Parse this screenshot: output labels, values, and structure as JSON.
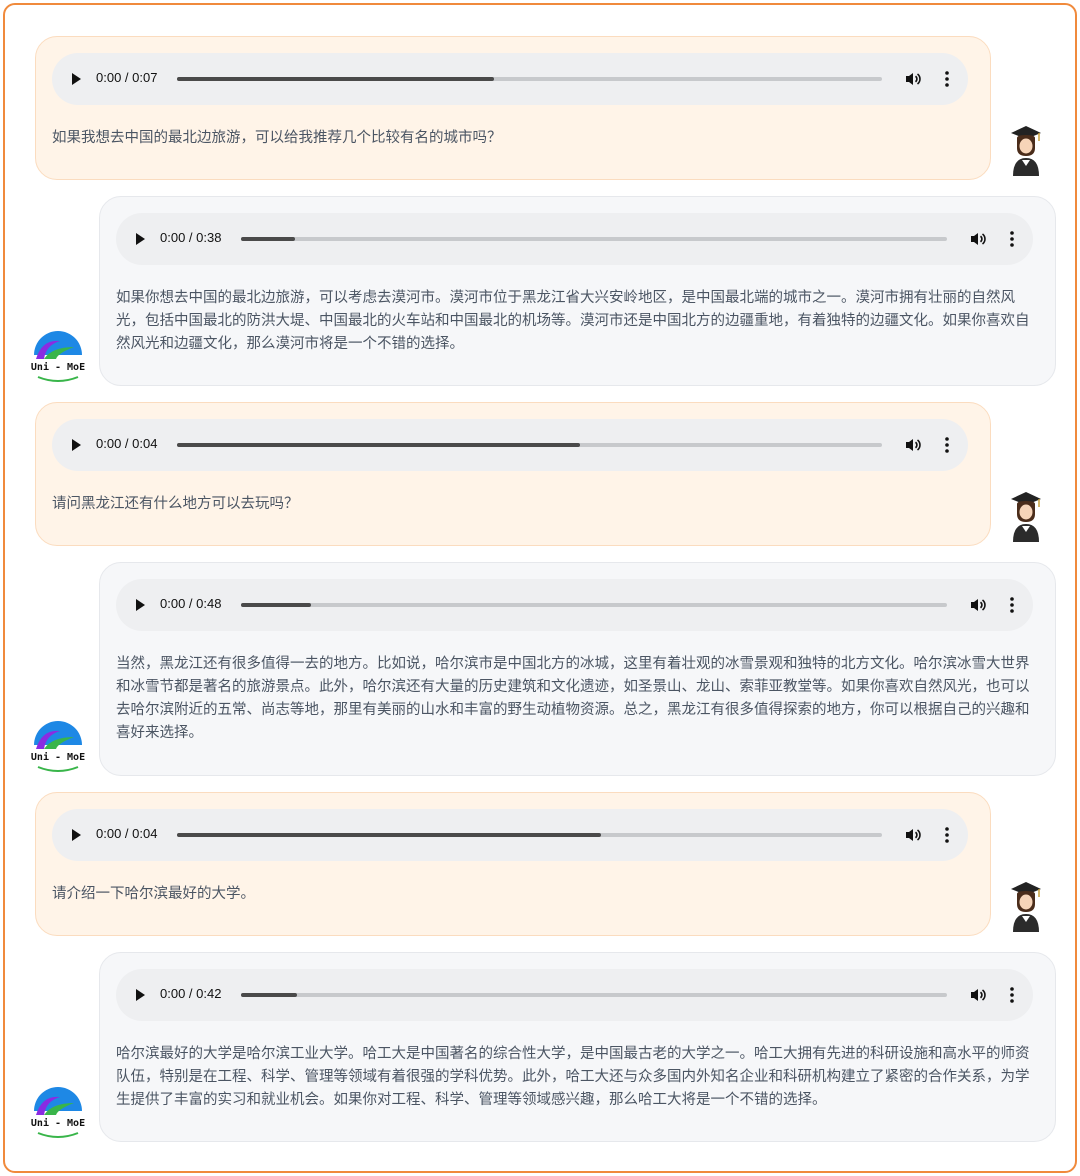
{
  "messages": [
    {
      "role": "user",
      "audio": {
        "time": "0:00 / 0:07",
        "progress": 0.45
      },
      "text": "如果我想去中国的最北边旅游，可以给我推荐几个比较有名的城市吗？"
    },
    {
      "role": "bot",
      "audio": {
        "time": "0:00 / 0:38",
        "progress": 0.076
      },
      "text": "如果你想去中国的最北边旅游，可以考虑去漠河市。漠河市位于黑龙江省大兴安岭地区，是中国最北端的城市之一。漠河市拥有壮丽的自然风光，包括中国最北的防洪大堤、中国最北的火车站和中国最北的机场等。漠河市还是中国北方的边疆重地，有着独特的边疆文化。如果你喜欢自然风光和边疆文化，那么漠河市将是一个不错的选择。"
    },
    {
      "role": "user",
      "audio": {
        "time": "0:00 / 0:04",
        "progress": 0.572
      },
      "text": "请问黑龙江还有什么地方可以去玩吗？"
    },
    {
      "role": "bot",
      "audio": {
        "time": "0:00 / 0:48",
        "progress": 0.099
      },
      "text": "当然，黑龙江还有很多值得一去的地方。比如说，哈尔滨市是中国北方的冰城，这里有着壮观的冰雪景观和独特的北方文化。哈尔滨冰雪大世界和冰雪节都是著名的旅游景点。此外，哈尔滨还有大量的历史建筑和文化遗迹，如圣景山、龙山、索菲亚教堂等。如果你喜欢自然风光，也可以去哈尔滨附近的五常、尚志等地，那里有美丽的山水和丰富的野生动植物资源。总之，黑龙江有很多值得探索的地方，你可以根据自己的兴趣和喜好来选择。"
    },
    {
      "role": "user",
      "audio": {
        "time": "0:00 / 0:04",
        "progress": 0.602
      },
      "text": "请介绍一下哈尔滨最好的大学。"
    },
    {
      "role": "bot",
      "audio": {
        "time": "0:00 / 0:42",
        "progress": 0.079
      },
      "text": "哈尔滨最好的大学是哈尔滨工业大学。哈工大是中国著名的综合性大学，是中国最古老的大学之一。哈工大拥有先进的科研设施和高水平的师资队伍，特别是在工程、科学、管理等领域有着很强的学科优势。此外，哈工大还与众多国内外知名企业和科研机构建立了紧密的合作关系，为学生提供了丰富的实习和就业机会。如果你对工程、科学、管理等领域感兴趣，那么哈工大将是一个不错的选择。"
    }
  ],
  "bot_logo_text": "Uni - MoE",
  "icons": {
    "play": "play-icon",
    "volume": "volume-icon",
    "more": "more-options-icon",
    "user_avatar": "graduate-student-icon",
    "bot_avatar": "uni-moe-logo"
  },
  "colors": {
    "border_accent": "#f08a3c",
    "user_bubble": "#fff4e8",
    "bot_bubble": "#f6f7f9",
    "logo_purple": "#8a2be2",
    "logo_green": "#39b54a",
    "logo_blue": "#1e88e5"
  }
}
